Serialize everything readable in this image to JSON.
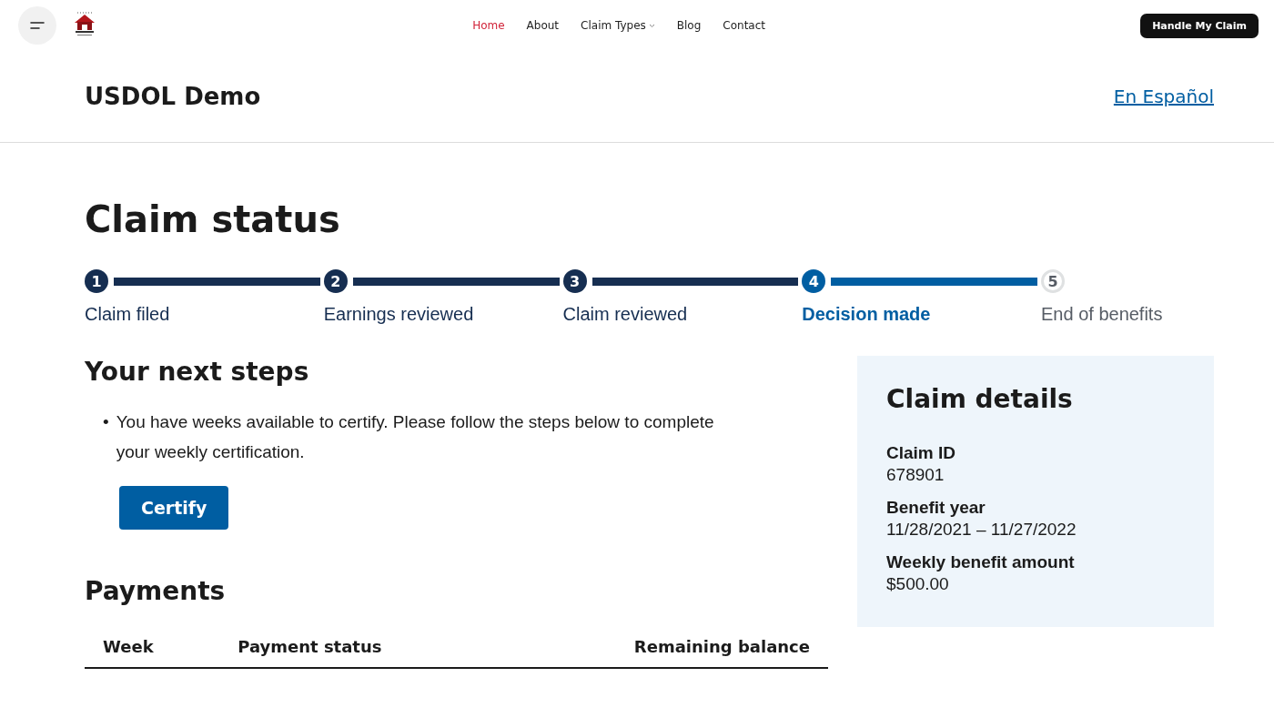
{
  "topnav": {
    "links": [
      {
        "label": "Home",
        "selected": true,
        "has_menu": false
      },
      {
        "label": "About",
        "selected": false,
        "has_menu": false
      },
      {
        "label": "Claim Types",
        "selected": false,
        "has_menu": true
      },
      {
        "label": "Blog",
        "selected": false,
        "has_menu": false
      },
      {
        "label": "Contact",
        "selected": false,
        "has_menu": false
      }
    ],
    "cta": "Handle My Claim"
  },
  "header": {
    "title": "USDOL Demo",
    "language_link": "En Español"
  },
  "page_title": "Claim status",
  "steps": [
    {
      "number": "1",
      "label": "Claim filed",
      "completed": true,
      "current": false
    },
    {
      "number": "2",
      "label": "Earnings reviewed",
      "completed": true,
      "current": false
    },
    {
      "number": "3",
      "label": "Claim reviewed",
      "completed": true,
      "current": false
    },
    {
      "number": "4",
      "label": "Decision made",
      "completed": false,
      "current": true
    },
    {
      "number": "5",
      "label": "End of benefits",
      "completed": false,
      "current": false
    }
  ],
  "next_steps": {
    "heading": "Your next steps",
    "items": [
      {
        "bullet": "•",
        "text": "You have weeks available to certify. Please follow the steps below to complete your weekly certification."
      }
    ],
    "button": "Certify"
  },
  "payments": {
    "heading": "Payments",
    "columns": [
      "Week",
      "Payment status",
      "Remaining balance"
    ]
  },
  "claim_details": {
    "heading": "Claim details",
    "fields": [
      {
        "label": "Claim ID",
        "value": "678901"
      },
      {
        "label": "Benefit year",
        "value": "11/28/2021 – 11/27/2022"
      },
      {
        "label": "Weekly benefit amount",
        "value": "$500.00"
      }
    ]
  }
}
